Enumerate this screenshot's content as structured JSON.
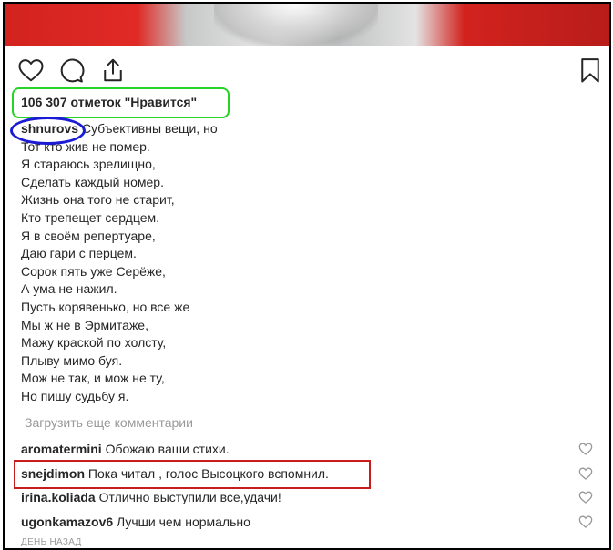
{
  "post": {
    "likes_text": "106 307 отметок \"Нравится\"",
    "author": "shnurovs",
    "caption_first": "Субъективны вещи, но",
    "caption_lines": [
      "Тот кто жив не помер.",
      "Я стараюсь зрелищно,",
      "Сделать каждый номер.",
      "Жизнь она того не старит,",
      "Кто трепещет сердцем.",
      "Я в своём репертуаре,",
      "Даю гари с перцем.",
      "Сорок пять уже Серёже,",
      "А ума не нажил.",
      "Пусть корявенько, но все же",
      "Мы ж не в Эрмитаже,",
      "Мажу краской по холсту,",
      "Плыву мимо буя.",
      "Мож не так, и мож не ту,",
      "Но пишу судьбу я."
    ],
    "load_more": "Загрузить еще комментарии",
    "timestamp": "ДЕНЬ НАЗАД"
  },
  "comments": [
    {
      "user": "aromatermini",
      "text": "Обожаю ваши стихи."
    },
    {
      "user": "snejdimon",
      "text": "Пока читал , голос Высоцкого вспомнил."
    },
    {
      "user": "irina.koliada",
      "text": "Отлично выступили все,удачи!"
    },
    {
      "user": "ugonkamazov6",
      "text": "Лучши чем нормально"
    }
  ],
  "icons": {
    "like": "heart-icon",
    "comment": "comment-bubble-icon",
    "share": "share-icon",
    "save": "bookmark-icon"
  },
  "colors": {
    "likes_highlight": "#27d327",
    "author_highlight": "#1b1bd6",
    "comment_highlight": "#c81c1c"
  }
}
